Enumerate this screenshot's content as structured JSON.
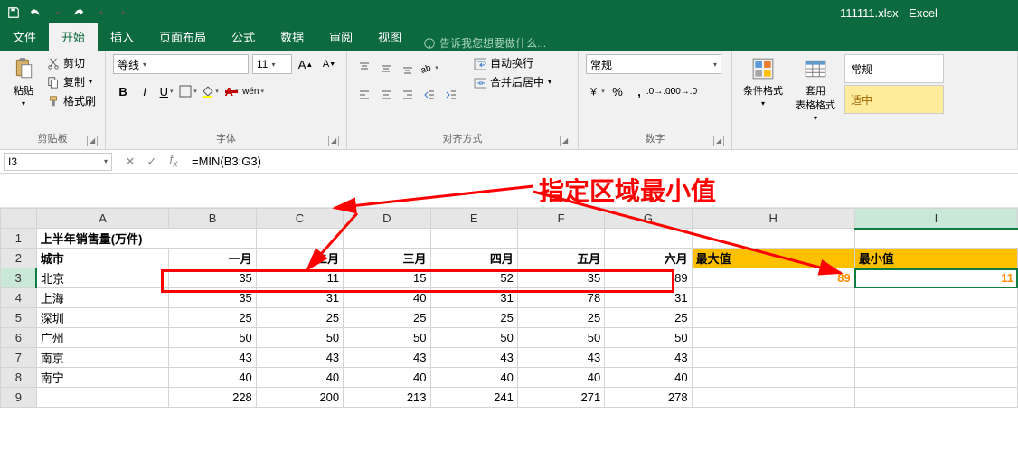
{
  "title": "111111.xlsx - Excel",
  "tabs": [
    "文件",
    "开始",
    "插入",
    "页面布局",
    "公式",
    "数据",
    "审阅",
    "视图"
  ],
  "active_tab": 1,
  "tellme": "告诉我您想要做什么...",
  "clipboard": {
    "paste": "粘贴",
    "cut": "剪切",
    "copy": "复制",
    "fmtpaint": "格式刷",
    "label": "剪贴板"
  },
  "font": {
    "name": "等线",
    "size": "11",
    "label": "字体",
    "wenA": "wén"
  },
  "align": {
    "wrap": "自动换行",
    "merge": "合并后居中",
    "label": "对齐方式"
  },
  "number": {
    "fmt": "常规",
    "label": "数字"
  },
  "styles": {
    "cond": "条件格式",
    "tbl": "套用\n表格格式",
    "cstyle1": "常规",
    "cstyle2": "适中"
  },
  "namebox": "I3",
  "formula": "=MIN(B3:G3)",
  "annotation": "指定区域最小值",
  "cols": [
    "A",
    "B",
    "C",
    "D",
    "E",
    "F",
    "G",
    "H",
    "I"
  ],
  "sheet": {
    "r1": {
      "A": "上半年销售量(万件)"
    },
    "r2": {
      "A": "城市",
      "B": "一月",
      "C": "二月",
      "D": "三月",
      "E": "四月",
      "F": "五月",
      "G": "六月",
      "H": "最大值",
      "I": "最小值"
    },
    "r3": {
      "A": "北京",
      "B": "35",
      "C": "11",
      "D": "15",
      "E": "52",
      "F": "35",
      "G": "89",
      "H": "89",
      "I": "11"
    },
    "r4": {
      "A": "上海",
      "B": "35",
      "C": "31",
      "D": "40",
      "E": "31",
      "F": "78",
      "G": "31"
    },
    "r5": {
      "A": "深圳",
      "B": "25",
      "C": "25",
      "D": "25",
      "E": "25",
      "F": "25",
      "G": "25"
    },
    "r6": {
      "A": "广州",
      "B": "50",
      "C": "50",
      "D": "50",
      "E": "50",
      "F": "50",
      "G": "50"
    },
    "r7": {
      "A": "南京",
      "B": "43",
      "C": "43",
      "D": "43",
      "E": "43",
      "F": "43",
      "G": "43"
    },
    "r8": {
      "A": "南宁",
      "B": "40",
      "C": "40",
      "D": "40",
      "E": "40",
      "F": "40",
      "G": "40"
    },
    "r9": {
      "B": "228",
      "C": "200",
      "D": "213",
      "E": "241",
      "F": "271",
      "G": "278"
    }
  }
}
